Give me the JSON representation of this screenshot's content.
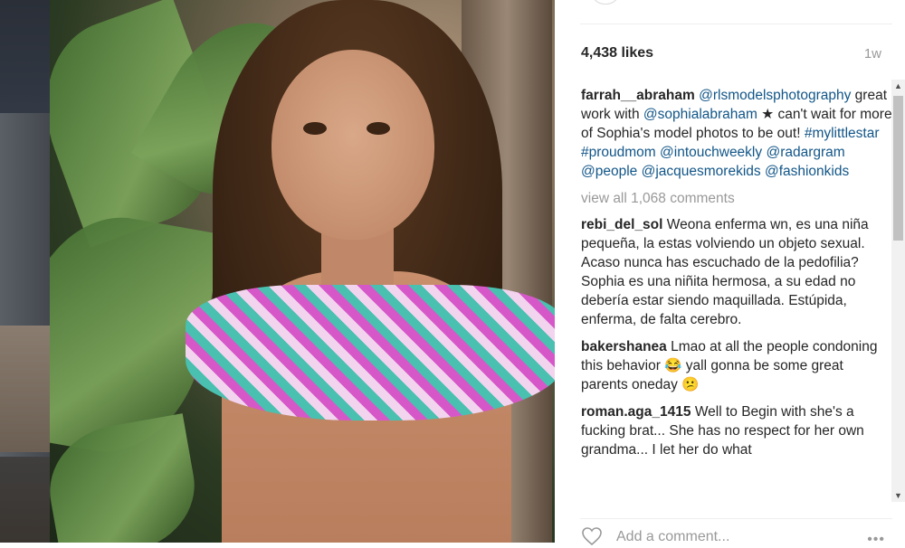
{
  "post": {
    "likes": "4,438 likes",
    "time": "1w",
    "caption": {
      "user": "farrah__abraham",
      "parts": [
        "@rlsmodelsphotography",
        " great work with ",
        "@sophialabraham",
        " ★ can't wait for more of Sophia's model photos to be out! ",
        "#mylittlestar",
        " ",
        "#proudmom",
        " ",
        "@intouchweekly",
        " ",
        "@radargram",
        " ",
        "@people",
        " ",
        "@jacquesmorekids",
        " ",
        "@fashionkids"
      ]
    },
    "view_all": "view all 1,068 comments",
    "comments": [
      {
        "user": "rebi_del_sol",
        "text": "Weona enferma wn, es una niña pequeña, la estas volviendo un objeto sexual. Acaso nunca has escuchado de la pedofilia? Sophia es una niñita hermosa, a su edad no debería estar siendo maquillada. Estúpida, enferma, de falta cerebro."
      },
      {
        "user": "bakershanea",
        "text": "Lmao at all the people condoning this behavior 😂 yall gonna be some great parents oneday 😕"
      },
      {
        "user": "roman.aga_1415",
        "text": "Well to Begin with she's a fucking brat... She has no respect for her own grandma... I let her do what"
      }
    ],
    "add_comment_placeholder": "Add a comment...",
    "more_label": "•••"
  },
  "icons": {
    "heart": "heart-icon",
    "more": "more-options-icon",
    "scroll_up": "▲",
    "scroll_down": "▼"
  },
  "colors": {
    "link": "#125688",
    "muted": "#999999",
    "text": "#262626"
  }
}
